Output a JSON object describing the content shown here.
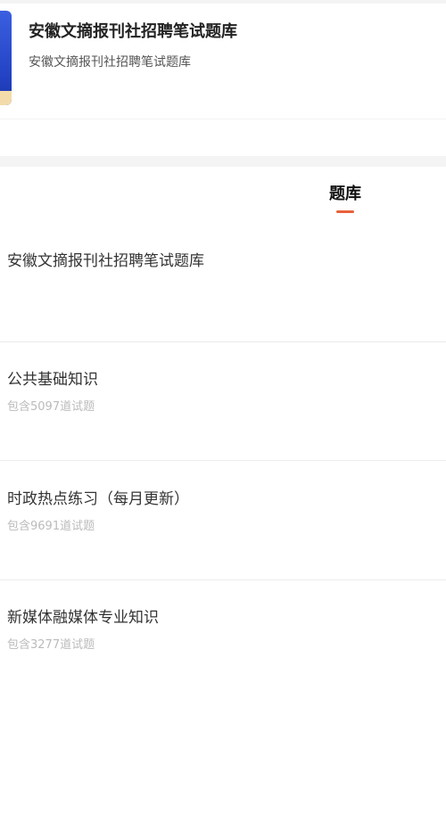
{
  "header": {
    "title": "安徽文摘报刊社招聘笔试题库",
    "subtitle": "安徽文摘报刊社招聘笔试题库"
  },
  "tabs": [
    {
      "label": "题库",
      "active": true
    }
  ],
  "section": {
    "title": "安徽文摘报刊社招聘笔试题库"
  },
  "banks": [
    {
      "name": "公共基础知识",
      "count": "包含5097道试题"
    },
    {
      "name": "时政热点练习（每月更新）",
      "count": "包含9691道试题"
    },
    {
      "name": "新媒体融媒体专业知识",
      "count": "包含3277道试题"
    }
  ],
  "colors": {
    "accent": "#e8613c",
    "cover": "#2342c4"
  }
}
